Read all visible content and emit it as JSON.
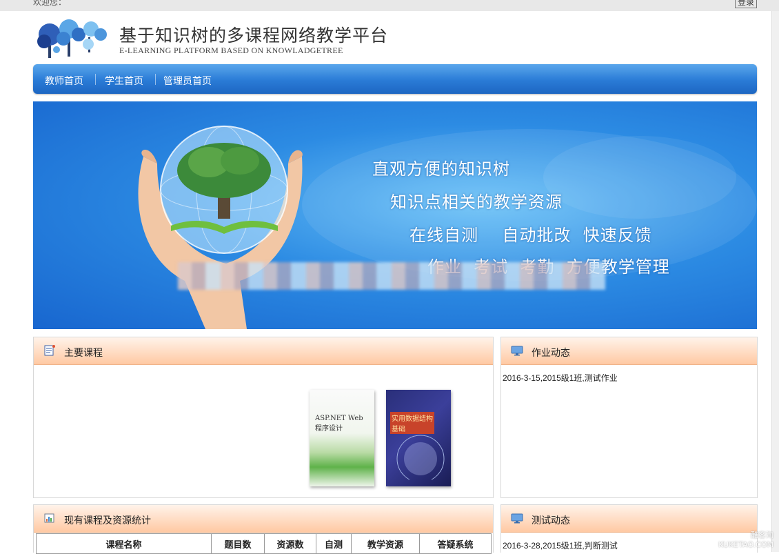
{
  "topbar": {
    "welcome": "欢迎您：",
    "login": "登录"
  },
  "header": {
    "title": "基于知识树的多课程网络教学平台",
    "subtitle": "E-LEARNING  PLATFORM BASED ON KNOWLADGETREE"
  },
  "nav": {
    "items": [
      "教师首页",
      "学生首页",
      "管理员首页"
    ]
  },
  "banner": {
    "lines": [
      "直观方便的知识树",
      "知识点相关的教学资源",
      "在线自测    自动批改  快速反馈",
      "作业  考试  考勤  方便教学管理"
    ]
  },
  "main_courses": {
    "title": "主要课程",
    "books": [
      {
        "title": "ASP.NET Web 程序设计"
      },
      {
        "title": "实用数据结构基础"
      }
    ]
  },
  "homework": {
    "title": "作业动态",
    "items": [
      "2016-3-15,2015级1班,测试作业"
    ]
  },
  "stats": {
    "title": "现有课程及资源统计",
    "columns": [
      "课程名称",
      "题目数",
      "资源数",
      "自测",
      "教学资源",
      "答疑系统"
    ]
  },
  "tests": {
    "title": "测试动态",
    "items": [
      "2016-3-28,2015级1班,判断测试"
    ]
  },
  "watermark": {
    "line1": "酷客淘",
    "line2": "KUKETAO.COM"
  },
  "colors": {
    "nav": "#2a7bd6",
    "panel_header": "#ffc9a3",
    "banner": "#2c8be3"
  }
}
